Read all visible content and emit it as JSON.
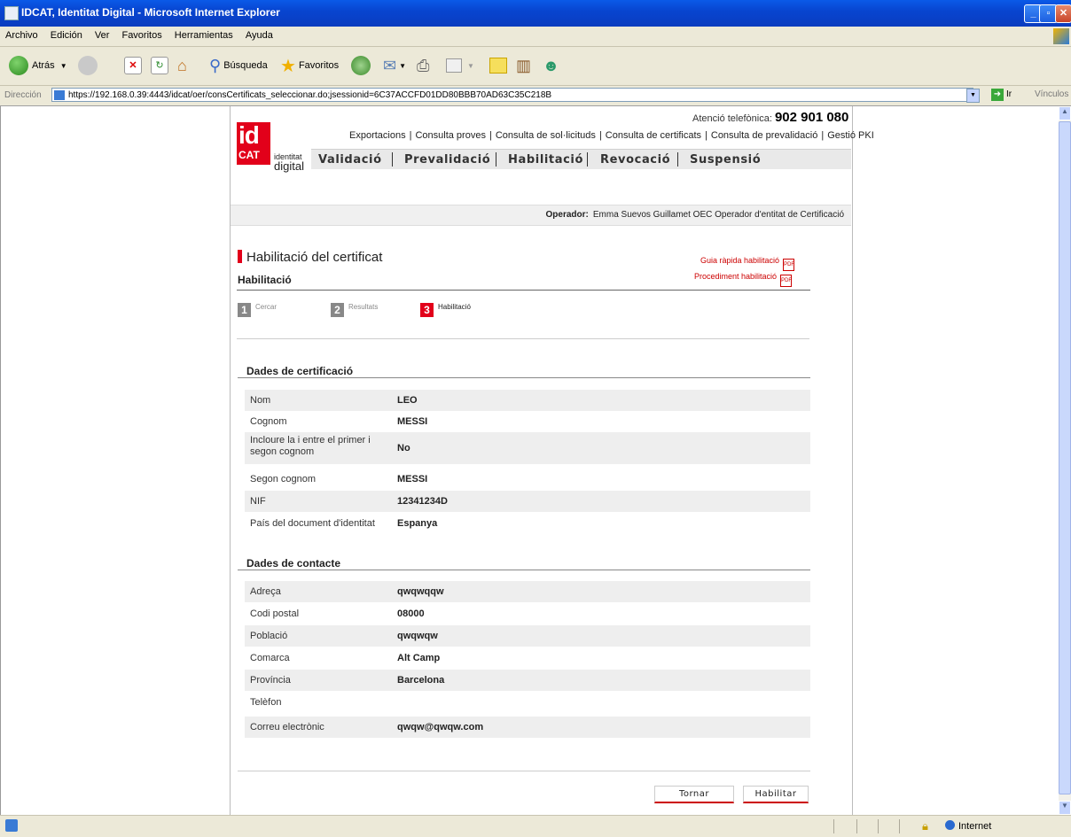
{
  "window": {
    "title": "IDCAT, Identitat Digital - Microsoft Internet Explorer"
  },
  "menubar": [
    "Archivo",
    "Edición",
    "Ver",
    "Favoritos",
    "Herramientas",
    "Ayuda"
  ],
  "toolbar": {
    "back_label": "Atrás",
    "search_label": "Búsqueda",
    "favorites_label": "Favoritos"
  },
  "addressbar": {
    "label": "Dirección",
    "url": "https://192.168.0.39:4443/idcat/oer/consCertificats_seleccionar.do;jsessionid=6C37ACCFD01DD80BBB70AD63C35C218B",
    "go_label": "Ir",
    "links_label": "Vínculos"
  },
  "header": {
    "phone_label": "Atenció telefònica:",
    "phone_number": "902 901 080",
    "top_links": [
      "Exportacions",
      "Consulta proves",
      "Consulta de sol·licituds",
      "Consulta de certificats",
      "Consulta de prevalidació",
      "Gestió PKI"
    ],
    "logo": {
      "id": "id",
      "cat": "CAT",
      "line1": "identitat",
      "line2": "digital"
    },
    "nav": [
      "Validació",
      "Prevalidació",
      "Habilitació",
      "Revocació",
      "Suspensió"
    ],
    "brand_color": "#e2001a"
  },
  "operator": {
    "label": "Operador:",
    "value": "Emma Suevos Guillamet OEC  Operador d'entitat de Certificació"
  },
  "page": {
    "title": "Habilitació del certificat",
    "subtitle": "Habilitació",
    "links": [
      "Guia ràpida habilitació",
      "Procediment habilitació"
    ],
    "steps": [
      {
        "num": "1",
        "label": "Cercar"
      },
      {
        "num": "2",
        "label": "Resultats"
      },
      {
        "num": "3",
        "label": "Habilitació"
      }
    ]
  },
  "certification": {
    "heading": "Dades de certificació",
    "rows": [
      {
        "k": "Nom",
        "v": "LEO"
      },
      {
        "k": "Cognom",
        "v": "MESSI"
      },
      {
        "k": "Incloure la i entre el primer i segon cognom",
        "v": "No"
      },
      {
        "k": "Segon cognom",
        "v": "MESSI"
      },
      {
        "k": "NIF",
        "v": "12341234D"
      },
      {
        "k": "País del document d'identitat",
        "v": "Espanya"
      }
    ]
  },
  "contact": {
    "heading": "Dades de contacte",
    "rows": [
      {
        "k": "Adreça",
        "v": "qwqwqqw"
      },
      {
        "k": "Codi postal",
        "v": "08000"
      },
      {
        "k": "Població",
        "v": "qwqwqw"
      },
      {
        "k": "Comarca",
        "v": "Alt Camp"
      },
      {
        "k": "Província",
        "v": "Barcelona"
      },
      {
        "k": "Telèfon",
        "v": ""
      },
      {
        "k": "Correu electrònic",
        "v": "qwqw@qwqw.com"
      }
    ]
  },
  "buttons": {
    "back": "Tornar",
    "submit": "Habilitar"
  },
  "statusbar": {
    "zone": "Internet"
  }
}
